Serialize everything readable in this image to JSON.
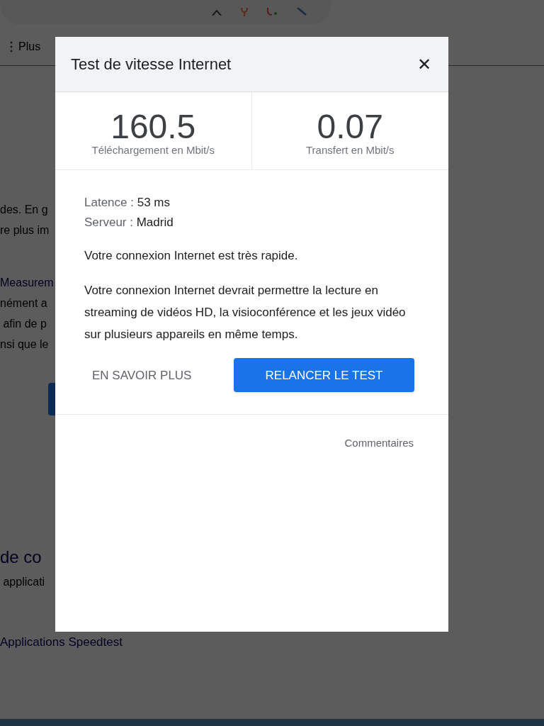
{
  "background_page": {
    "menu_label": "Plus",
    "paragraph_lines": [
      "des. En g",
      "re plus im"
    ],
    "link": "Measurem",
    "more_lines": [
      "nément a",
      " afin de p",
      "nsi que le"
    ],
    "heading": "de co",
    "sub_line": " applicati",
    "bottom_link": "Applications Speedtest"
  },
  "dialog": {
    "title": "Test de vitesse Internet",
    "close": "✕",
    "stats": [
      {
        "value": "160.5",
        "label": "Téléchargement en Mbit/s"
      },
      {
        "value": "0.07",
        "label": "Transfert en Mbit/s"
      }
    ],
    "details": [
      {
        "label": "Latence : ",
        "value": "53 ms"
      },
      {
        "label": "Serveur : ",
        "value": "Madrid"
      }
    ],
    "verdict": "Votre connexion Internet est très rapide.",
    "description": "Votre connexion Internet devrait permettre la lecture en streaming de vidéos HD, la visioconférence et les jeux vidéo sur plusieurs appareils en même temps.",
    "buttons": [
      {
        "kind": "text",
        "label": "EN SAVOIR PLUS"
      },
      {
        "kind": "primary",
        "label": "RELANCER LE TEST"
      }
    ],
    "feedback": "Commentaires"
  }
}
